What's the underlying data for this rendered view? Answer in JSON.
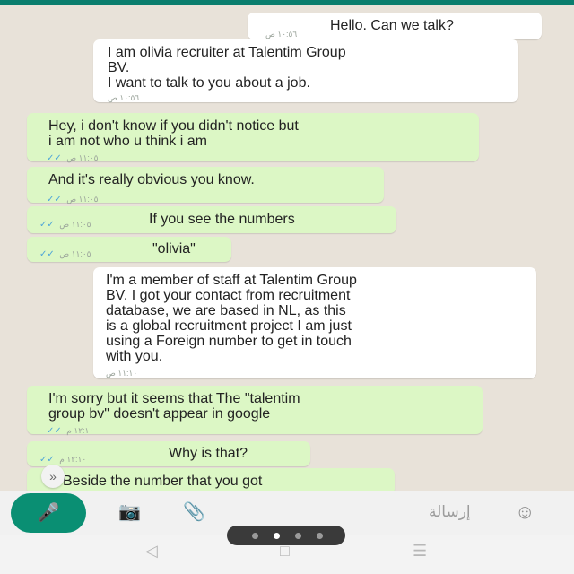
{
  "messages": [
    {
      "dir": "in",
      "text": "Hello. Can we talk?",
      "time": "١٠:٥٦ ص"
    },
    {
      "dir": "in",
      "text": "I am olivia recruiter at Talentim Group\nBV.\nI want to talk to you about a job.",
      "time": "١٠:٥٦ ص"
    },
    {
      "dir": "out",
      "text": "Hey, i don't know if you didn't notice but\ni am not who u think i am",
      "time": "١١:٠٥ ص"
    },
    {
      "dir": "out",
      "text": "And it's really obvious you know.",
      "time": "١١:٠٥ ص"
    },
    {
      "dir": "out",
      "text": "If you see the numbers",
      "time": "١١:٠٥ ص"
    },
    {
      "dir": "out",
      "text": "\"olivia\"",
      "time": "١١:٠٥ ص"
    },
    {
      "dir": "in",
      "text": "I'm a member of staff at Talentim Group\nBV. I got your contact from recruitment\ndatabase, we are based in NL, as this\nis a global recruitment project I am just\nusing a Foreign number to get in touch\nwith you.",
      "time": "١١:١٠ ص"
    },
    {
      "dir": "out",
      "text": "I'm sorry but it seems that The \"talentim\ngroup bv\" doesn't appear in google",
      "time": "١٢:١٠ م"
    },
    {
      "dir": "out",
      "text": "Why is that?",
      "time": "١٢:١٠ م"
    },
    {
      "dir": "out",
      "text": "Beside the number that you got",
      "time": "١٢:١٠ م"
    }
  ],
  "ticks": "✓✓",
  "scroll_down_icon": "»",
  "input": {
    "placeholder": "إرسالة",
    "mic_icon": "🎤",
    "camera_icon": "📷",
    "attach_icon": "📎",
    "emoji_icon": "☺"
  },
  "nav": {
    "back_icon": "◁",
    "home_icon": "□",
    "recents_icon": "☰"
  },
  "colors": {
    "incoming_bubble": "#ffffff",
    "outgoing_bubble": "#dcf7c5",
    "accent": "#0a8f73",
    "ticks": "#4fa6d8"
  }
}
